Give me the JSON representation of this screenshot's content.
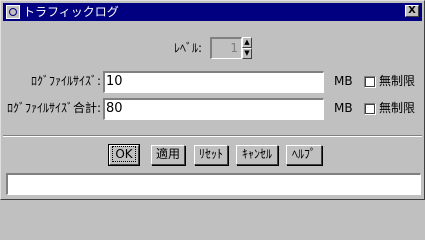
{
  "window": {
    "title": "トラフィックログ",
    "close_glyph": "X"
  },
  "level": {
    "label": "ﾚﾍﾞﾙ:",
    "value": "1"
  },
  "log_file_size": {
    "label": "ﾛｸﾞﾌｧｲﾙｻｲｽﾞ:",
    "value": "10",
    "unit": "MB",
    "unlimited_label": "無制限"
  },
  "log_file_size_total": {
    "label": "ﾛｸﾞﾌｧｲﾙｻｲｽﾞ合計:",
    "value": "80",
    "unit": "MB",
    "unlimited_label": "無制限"
  },
  "buttons": {
    "ok": "OK",
    "apply": "適用",
    "reset": "ﾘｾｯﾄ",
    "cancel": "ｷｬﾝｾﾙ",
    "help": "ﾍﾙﾌﾟ"
  },
  "status": {
    "message": ""
  }
}
